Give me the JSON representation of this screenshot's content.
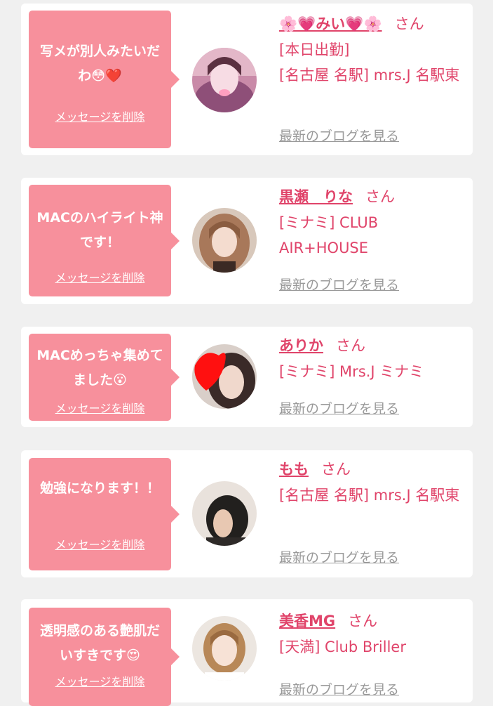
{
  "colors": {
    "background": "#f0f0f0",
    "card": "#ffffff",
    "bubble": "#f7909c",
    "name": "#e0446a",
    "shop": "#e0446a",
    "blog_link": "#9a9a9a"
  },
  "items": [
    {
      "message": "写メが別人みたいだわ😳❤️",
      "delete_label": "メッセージを削除",
      "name": "🌸💗みい💗🌸",
      "honorific": "さん",
      "status": "[本日出勤]",
      "shop": "[名古屋 名駅] mrs.J 名駅東",
      "blog_label": "最新のブログを見る"
    },
    {
      "message": "MACのハイライト神です！",
      "delete_label": "メッセージを削除",
      "name": "黒瀬　りな",
      "honorific": "さん",
      "shop": "[ミナミ] CLUB AIR+HOUSE",
      "blog_label": "最新のブログを見る"
    },
    {
      "message": "MACめっちゃ集めてました😮",
      "delete_label": "メッセージを削除",
      "name": "ありか",
      "honorific": "さん",
      "shop": "[ミナミ] Mrs.J ミナミ",
      "blog_label": "最新のブログを見る"
    },
    {
      "message": "勉強になります！！",
      "delete_label": "メッセージを削除",
      "name": "もも",
      "honorific": "さん",
      "shop": "[名古屋 名駅] mrs.J 名駅東",
      "blog_label": "最新のブログを見る"
    },
    {
      "message": "透明感のある艶肌だいすきです😍",
      "delete_label": "メッセージを削除",
      "name": "美香MG",
      "honorific": "さん",
      "shop": "[天満] Club Briller",
      "blog_label": "最新のブログを見る"
    }
  ]
}
